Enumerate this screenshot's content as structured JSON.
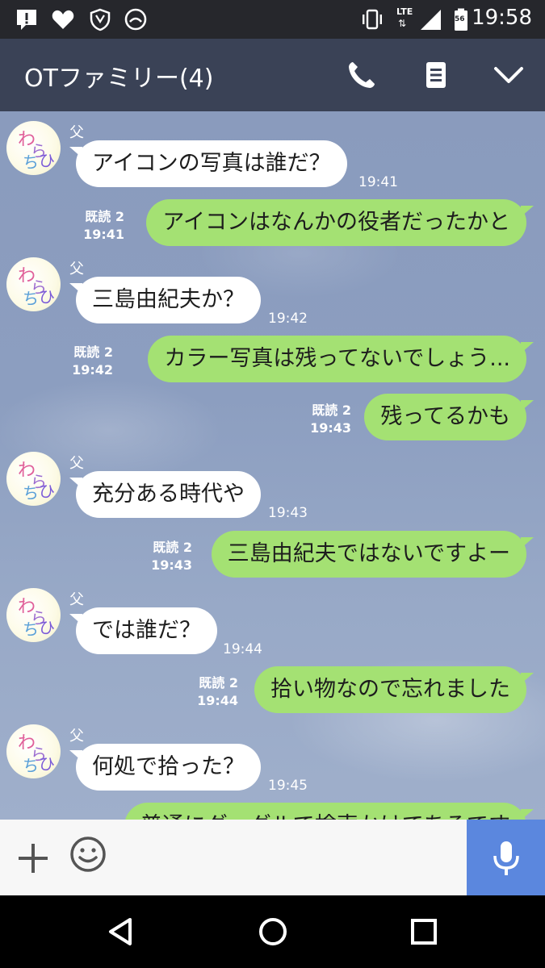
{
  "status_bar": {
    "time": "19:58",
    "network_label": "LTE",
    "battery_level": "56",
    "icons": [
      "alert-icon",
      "heart-icon",
      "shield-icon",
      "smile-icon",
      "vibrate-icon",
      "signal-icon",
      "battery-icon"
    ]
  },
  "header": {
    "title": "OTファミリー(4)",
    "icons": [
      "phone-icon",
      "notes-icon",
      "chevron-down-icon"
    ]
  },
  "messages": [
    {
      "direction": "in",
      "sender": "父",
      "text": "アイコンの写真は誰だ？",
      "time": "19:41"
    },
    {
      "direction": "out",
      "read": "既読 2",
      "time": "19:41",
      "text": "アイコンはなんかの役者だったかと"
    },
    {
      "direction": "in",
      "sender": "父",
      "text": "三島由紀夫か？",
      "time": "19:42"
    },
    {
      "direction": "out",
      "read": "既読 2",
      "time": "19:42",
      "text": "カラー写真は残ってないでしょう..."
    },
    {
      "direction": "out",
      "read": "既読 2",
      "time": "19:43",
      "text": "残ってるかも"
    },
    {
      "direction": "in",
      "sender": "父",
      "text": "充分ある時代や",
      "time": "19:43"
    },
    {
      "direction": "out",
      "read": "既読 2",
      "time": "19:43",
      "text": "三島由紀夫ではないですよー"
    },
    {
      "direction": "in",
      "sender": "父",
      "text": "では誰だ？",
      "time": "19:44"
    },
    {
      "direction": "out",
      "read": "既読 2",
      "time": "19:44",
      "text": "拾い物なので忘れました"
    },
    {
      "direction": "in",
      "sender": "父",
      "text": "何処で拾った？",
      "time": "19:45"
    },
    {
      "direction": "out",
      "text": "普通にグーグルで検索かけてあるです"
    }
  ],
  "input_bar": {
    "icons": [
      "plus-icon",
      "emoji-icon",
      "mic-icon"
    ]
  },
  "nav_bar": {
    "icons": [
      "back-icon",
      "home-icon",
      "recents-icon"
    ]
  },
  "colors": {
    "header_bg": "#3a4256",
    "status_bg": "#26272c",
    "bubble_out": "#a4e173",
    "bubble_in": "#ffffff",
    "mic_bg": "#5b87de"
  }
}
